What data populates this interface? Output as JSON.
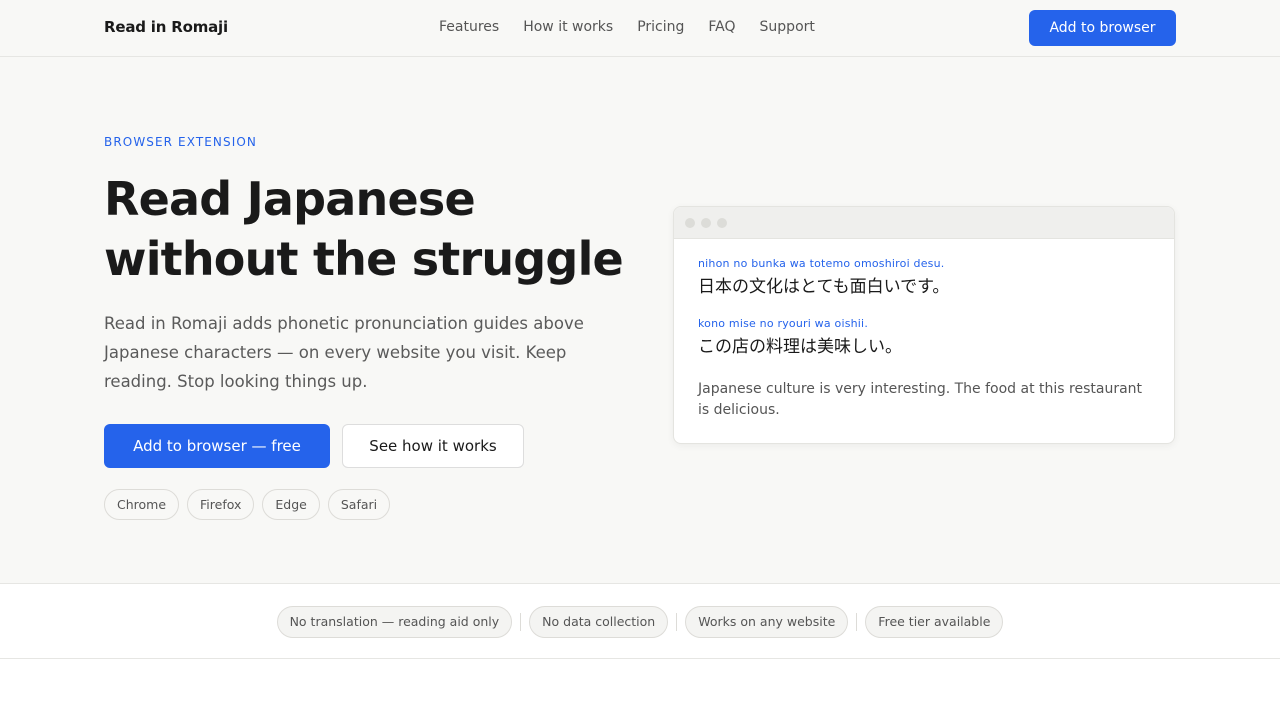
{
  "header": {
    "brand": "Read in Romaji",
    "nav": [
      "Features",
      "How it works",
      "Pricing",
      "FAQ",
      "Support"
    ],
    "cta": "Add to browser"
  },
  "hero": {
    "eyebrow": "BROWSER EXTENSION",
    "headline_line1": "Read Japanese",
    "headline_line2": "without the struggle",
    "lede": "Read in Romaji adds phonetic pronunciation guides above Japanese characters — on every website you visit. Keep reading. Stop looking things up.",
    "primary_cta": "Add to browser — free",
    "secondary_cta": "See how it works",
    "browsers": [
      "Chrome",
      "Firefox",
      "Edge",
      "Safari"
    ]
  },
  "demo": {
    "line1_romaji": "nihon no bunka wa totemo omoshiroi desu.",
    "line1_japanese": "日本の文化はとても面白いです。",
    "line2_romaji": "kono mise no ryouri wa oishii.",
    "line2_japanese": "この店の料理は美味しい。",
    "translation": "Japanese culture is very interesting. The food at this restaurant is delicious."
  },
  "features": [
    "No translation — reading aid only",
    "No data collection",
    "Works on any website",
    "Free tier available"
  ],
  "colors": {
    "accent": "#2563eb",
    "background": "#f8f8f6",
    "text": "#1a1a1a"
  }
}
